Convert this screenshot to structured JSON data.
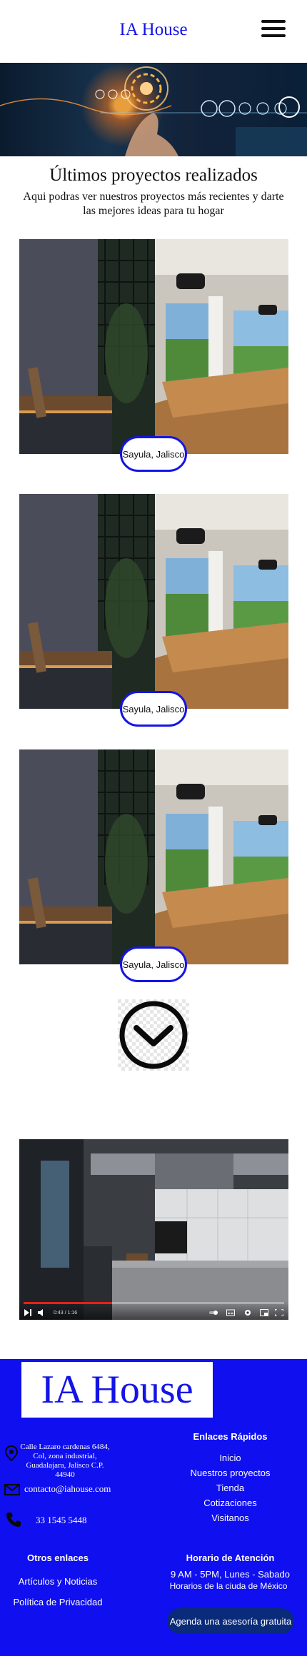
{
  "header": {
    "brand": "IA House"
  },
  "projects": {
    "title": "Últimos proyectos realizados",
    "subtitle": "Aqui podras ver nuestros proyectos más recientes y darte las mejores ideas para tu hogar",
    "items": [
      {
        "location": "Sayula, Jalisco"
      },
      {
        "location": "Sayula, Jalisco"
      },
      {
        "location": "Sayula, Jalisco"
      }
    ]
  },
  "video": {
    "time": "0:43 / 1:16",
    "progress": 0.34
  },
  "footer": {
    "logo": "IA House",
    "address": "Calle Lazaro cardenas 6484, Col, zona industrial, Guadalajara, Jalisco C.P. 44940",
    "email": "contacto@iahouse.com",
    "phone": "33 1545 5448",
    "quick_links_title": "Enlaces Rápidos",
    "quick_links": [
      "Inicio",
      "Nuestros proyectos",
      "Tienda",
      "Cotizaciones",
      "Visitanos"
    ],
    "other_links_title": "Otros enlaces",
    "other_links": [
      "Artículos y Noticias",
      "Política de Privacidad"
    ],
    "hours_title": "Horario de Atención",
    "hours_line1": "9 AM - 5PM, Lunes - Sabado",
    "hours_line2": "Horarios de la ciuda de México",
    "cta": "Agenda una asesoría gratuita"
  },
  "colors": {
    "brand_blue": "#1414e6",
    "footer_blue": "#0f0ff0",
    "cta_bg": "#0a2a7a",
    "video_progress": "#e62117"
  }
}
